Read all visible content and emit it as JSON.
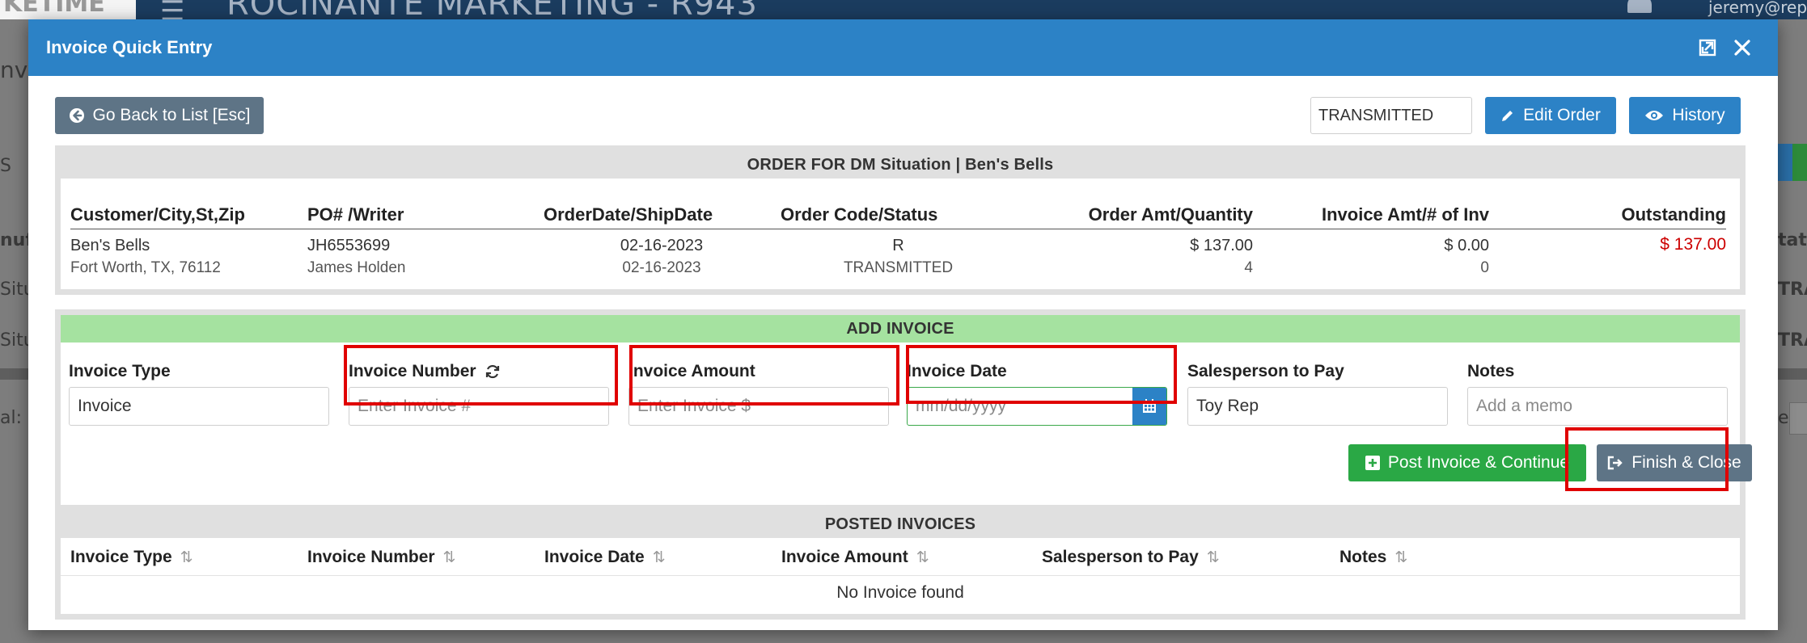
{
  "background": {
    "logo_text": "KETIME",
    "menu_glyph": "☰",
    "title": "ROCINANTE MARKETING - R943",
    "user": "jeremy@repi",
    "frag_left_1": "nv",
    "frag_left_2": "S",
    "frag_left_3": "nuf",
    "frag_left_4": "Situ",
    "frag_left_5": "Situ",
    "frag_left_6": "al:",
    "frag_right_1": "tatu",
    "frag_right_2": "TRAN",
    "frag_right_3": "TRAN",
    "frag_right_4": "e:"
  },
  "modal": {
    "title": "Invoice Quick Entry",
    "back_button": "Go Back to List [Esc]",
    "status_select": {
      "value": "TRANSMITTED"
    },
    "edit_order_button": "Edit Order",
    "history_button": "History"
  },
  "order": {
    "heading": "ORDER FOR DM Situation | Ben's Bells",
    "columns": {
      "customer": "Customer/City,St,Zip",
      "po": "PO# /Writer",
      "dates": "OrderDate/ShipDate",
      "code": "Order Code/Status",
      "amount": "Order Amt/Quantity",
      "invoice": "Invoice Amt/# of Inv",
      "outstanding": "Outstanding"
    },
    "row": {
      "customer": "Ben's Bells",
      "city": "Fort Worth, TX, 76112",
      "po": "JH6553699",
      "writer": "James Holden",
      "order_date": "02-16-2023",
      "ship_date": "02-16-2023",
      "code": "R",
      "status": "TRANSMITTED",
      "order_amt": "$ 137.00",
      "quantity": "4",
      "invoice_amt": "$ 0.00",
      "num_inv": "0",
      "outstanding": "$ 137.00"
    }
  },
  "add_invoice": {
    "heading": "ADD INVOICE",
    "invoice_type_label": "Invoice Type",
    "invoice_type_value": "Invoice",
    "invoice_number_label": "Invoice Number",
    "invoice_number_placeholder": "Enter Invoice #",
    "invoice_amount_label": "Invoice Amount",
    "invoice_amount_placeholder": "Enter Invoice $",
    "invoice_date_label": "Invoice Date",
    "invoice_date_placeholder": "mm/dd/yyyy",
    "salesperson_label": "Salesperson to Pay",
    "salesperson_value": "Toy Rep",
    "notes_label": "Notes",
    "notes_placeholder": "Add a memo",
    "post_button": "Post Invoice & Continue",
    "finish_button": "Finish & Close"
  },
  "posted": {
    "heading": "POSTED INVOICES",
    "columns": [
      "Invoice Type",
      "Invoice Number",
      "Invoice Date",
      "Invoice Amount",
      "Salesperson to Pay",
      "Notes"
    ],
    "sort_glyph": "⇅",
    "empty_text": "No Invoice found"
  },
  "colors": {
    "header_blue": "#2c82c6",
    "add_invoice_green": "#a5e2a0",
    "post_button_green": "#2aa845",
    "outstanding_red": "#cc0000",
    "highlight_red": "#e00000"
  }
}
